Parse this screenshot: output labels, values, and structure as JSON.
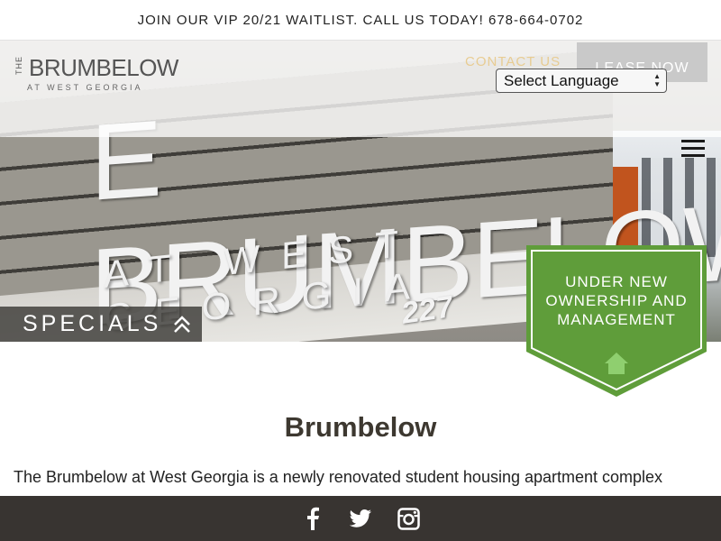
{
  "announcement": "JOIN OUR VIP 20/21 WAITLIST. CALL US TODAY! 678-664-0702",
  "logo": {
    "the": "THE",
    "name": "BRUMBELOW",
    "sub": "AT WEST GEORGIA"
  },
  "nav": {
    "contact_label": "CONTACT US",
    "lease_label": "LEASE NOW",
    "language_selected": "Select Language",
    "menu_icon": "hamburger-menu-icon"
  },
  "hero": {
    "sign_main": "E BRUMBELOW",
    "sign_sub": "AT WEST GEORGIA",
    "sign_number": "227",
    "specials_label": "SPECIALS",
    "specials_icon": "double-chevron-up-icon",
    "badge_text": "UNDER NEW OWNERSHIP AND MANAGEMENT",
    "badge_icon": "home-icon"
  },
  "content": {
    "title": "Brumbelow",
    "intro": "The Brumbelow at West Georgia is a newly renovated student housing apartment complex"
  },
  "footer": {
    "icons": [
      "facebook-icon",
      "twitter-icon",
      "instagram-icon"
    ]
  },
  "colors": {
    "badge_green": "#5f9d3a",
    "footer_bg": "#383431",
    "contact_gold": "#e8c98a"
  }
}
